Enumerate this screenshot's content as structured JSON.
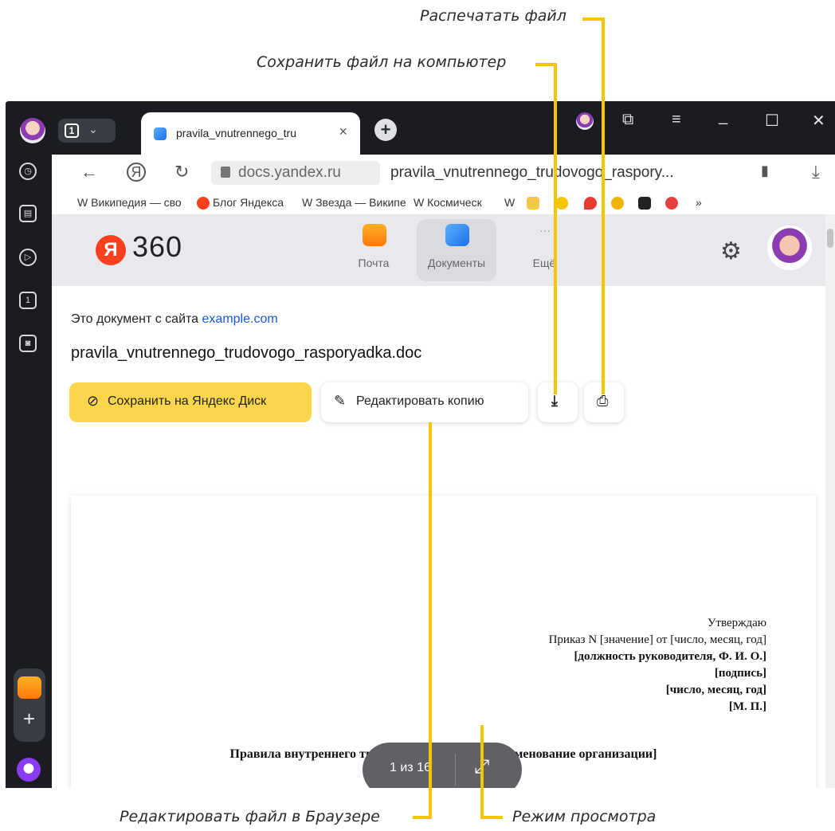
{
  "callouts": {
    "print": "Распечатать файл",
    "save_to_pc": "Сохранить файл на компьютер",
    "edit_in_browser": "Редактировать файл в Браузере",
    "view_mode": "Режим просмотра"
  },
  "browser": {
    "tab_count": "1",
    "tab_title": "pravila_vnutrennego_tru",
    "address_domain": "docs.yandex.ru",
    "address_path": "pravila_vnutrennego_trudovogo_raspory...",
    "bookmarks": [
      "W Википедия — сво",
      "Блог Яндекса",
      "W Звезда — Википе",
      "W Космическ",
      "W"
    ],
    "rail_tab_count": "1"
  },
  "header": {
    "logo_letter": "Я",
    "logo_text": "360",
    "services": [
      "Почта",
      "Документы",
      "Ещё"
    ]
  },
  "doc": {
    "source_prefix": "Это документ с сайта",
    "source_link": "example.com",
    "filename": "pravila_vnutrennego_trudovogo_rasporyadka.doc",
    "save_disk": "Сохранить на Яндекс Диск",
    "edit_copy": "Редактировать копию"
  },
  "preview": {
    "approve_lines": [
      "Утверждаю",
      "Приказ N [значение] от [число, месяц, год]",
      "[должность руководителя, Ф. И. О.]",
      "[подпись]",
      "[число, месяц, год]",
      "[М. П.]"
    ],
    "heading": "Правила внутреннего трудового распорядка [наименование организации]",
    "pages": "1 из 16"
  },
  "colors": {
    "accent": "#f5c500",
    "save_button": "#fbd64d",
    "yandex_red": "#fc3f1d",
    "link": "#1a57db"
  }
}
